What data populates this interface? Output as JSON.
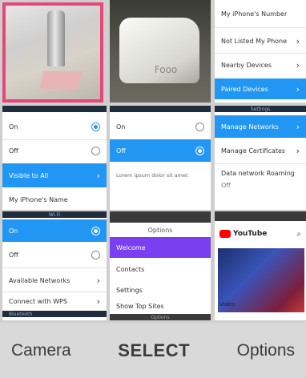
{
  "softkeys": {
    "left": "Camera",
    "center": "SELECT",
    "right": "Options"
  },
  "tile_top_right": {
    "items": [
      "My iPhone's Number",
      "Not Listed My Phone",
      "Nearby Devices",
      "Paired Devices"
    ]
  },
  "tile_mid_left": {
    "items": [
      "On",
      "Off",
      "Visible to All",
      "My iPhone's Name"
    ]
  },
  "tile_mid_center": {
    "items": [
      "On",
      "Off"
    ],
    "note": "Lorem ipsum dolor sit amet"
  },
  "tile_mid_right": {
    "header": "Settings",
    "items": [
      "Manage Networks",
      "Manage Certificates",
      "Data network Roaming",
      "Off"
    ]
  },
  "tile_bottom_left": {
    "header": "Wi-Fi",
    "items": [
      "On",
      "Off",
      "Available Networks",
      "Connect with WPS",
      "Bluetooth"
    ]
  },
  "tile_bottom_center": {
    "header": "Options",
    "items": [
      "Welcome",
      "Contacts",
      "Settings",
      "Show Top Sites"
    ],
    "footer": "Options"
  },
  "tile_bottom_right": {
    "topbar": "YouTube",
    "caption": "Video"
  },
  "photo_bag_text": "Fooo",
  "colors": {
    "accent": "#2196f3",
    "purple": "#7a3ff0",
    "softkey_bg": "#d9d9d9",
    "photo_border": "#e8457a"
  },
  "icons": [
    "chevron-right-icon",
    "radio-icon",
    "youtube-logo-icon",
    "search-icon"
  ]
}
